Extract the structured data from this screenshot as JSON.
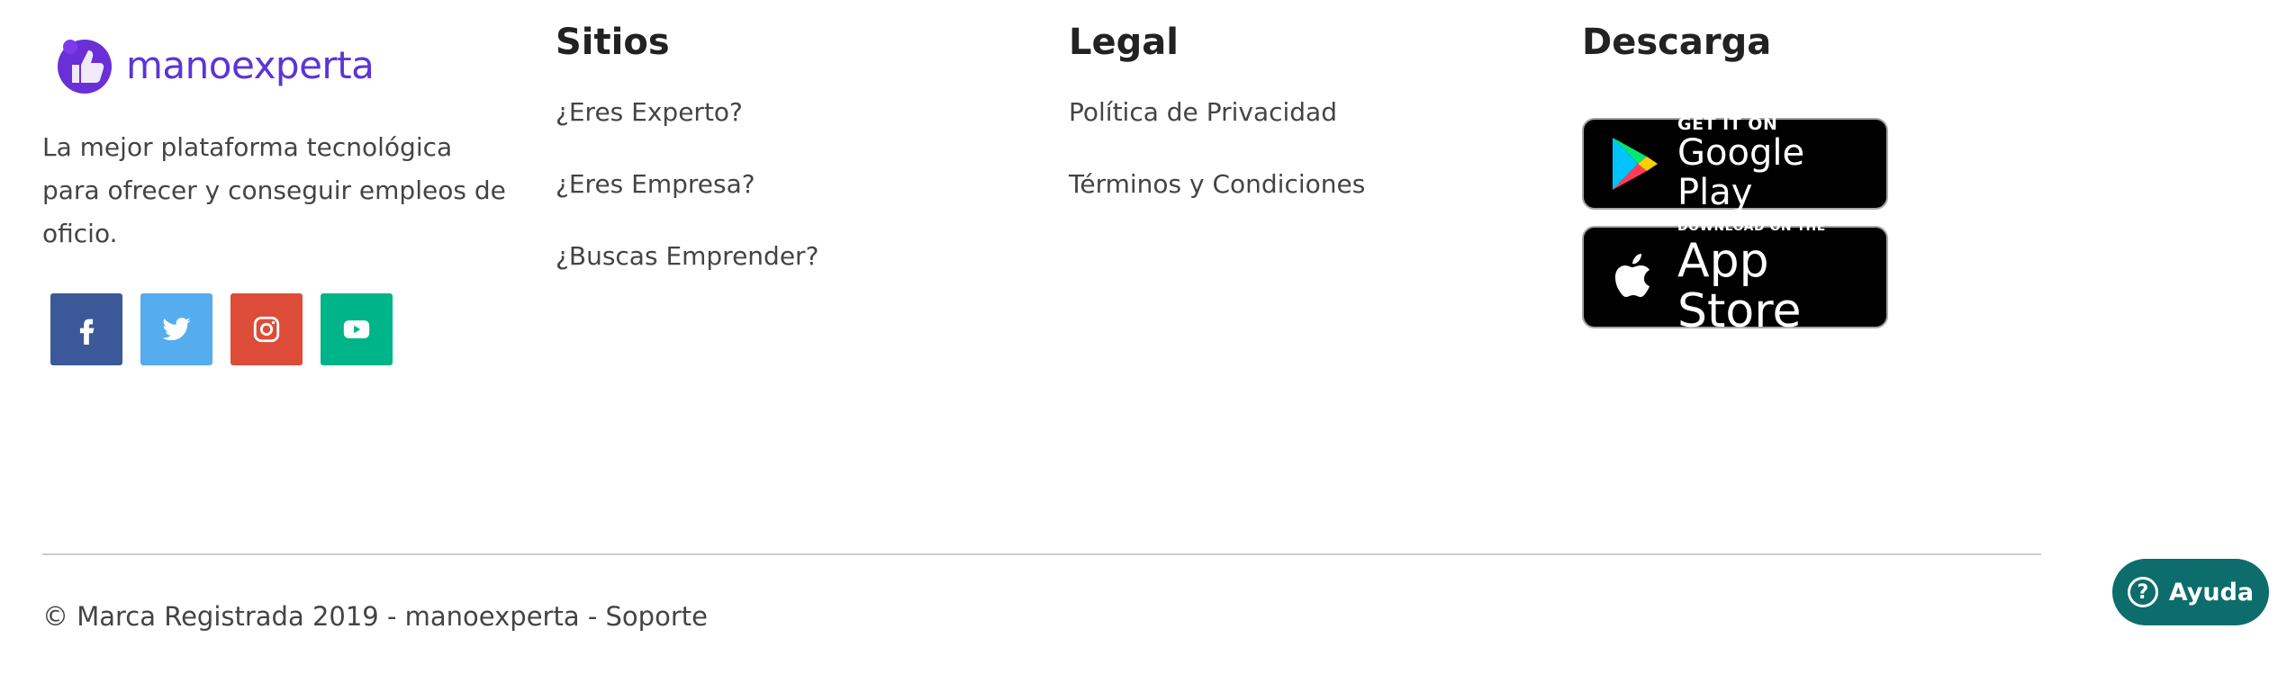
{
  "brand": {
    "name": "manoexperta",
    "tagline": "La mejor plataforma tecnológica para ofrecer y conseguir empleos de oficio.",
    "color": "#5b35d5"
  },
  "social": [
    {
      "icon": "facebook-icon",
      "color": "#3b5998"
    },
    {
      "icon": "twitter-icon",
      "color": "#55acee"
    },
    {
      "icon": "instagram-icon",
      "color": "#dd4b39"
    },
    {
      "icon": "youtube-icon",
      "color": "#00b489"
    }
  ],
  "sitios": {
    "title": "Sitios",
    "links": [
      "¿Eres Experto?",
      "¿Eres Empresa?",
      "¿Buscas Emprender?"
    ]
  },
  "legal": {
    "title": "Legal",
    "links": [
      "Política de Privacidad",
      "Términos y Condiciones"
    ]
  },
  "descarga": {
    "title": "Descarga",
    "google_play": {
      "small": "GET IT ON",
      "big": "Google Play"
    },
    "app_store": {
      "small": "DOWNLOAD ON THE",
      "big": "App Store"
    }
  },
  "footer": {
    "copyright": "© Marca Registrada 2019 - manoexperta - ",
    "support": "Soporte"
  },
  "help": {
    "label": "Ayuda",
    "color": "#0d6c6c"
  }
}
